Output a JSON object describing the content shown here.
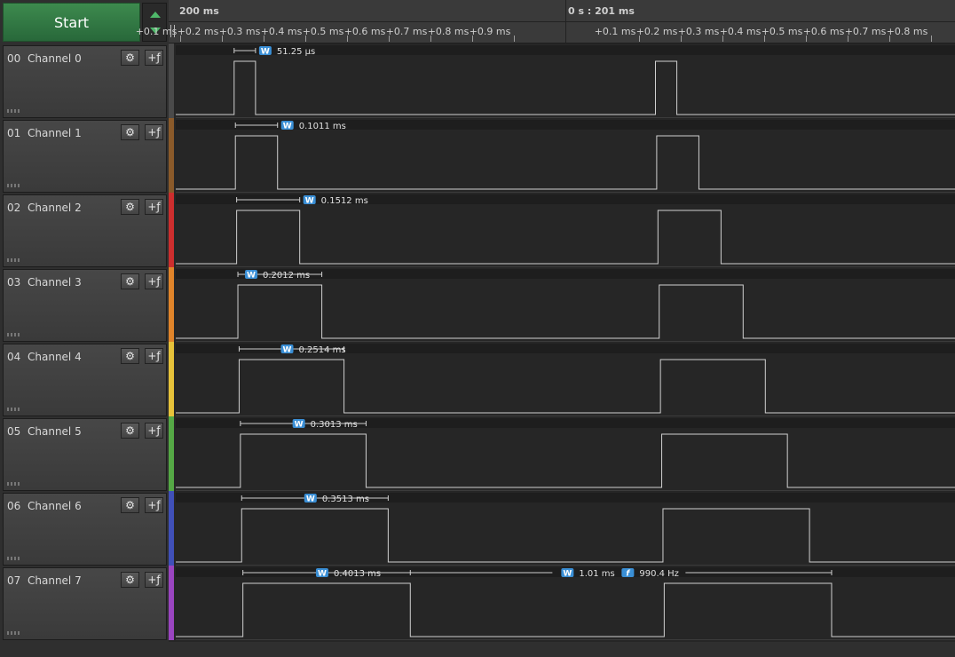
{
  "controls": {
    "start_label": "Start"
  },
  "timeline": {
    "left_label": "200 ms",
    "center_label": "0 s : 201 ms",
    "ticks_left": [
      "+0.1 ms",
      "+0.2 ms",
      "+0.3 ms",
      "+0.4 ms",
      "+0.5 ms",
      "+0.6 ms",
      "+0.7 ms",
      "+0.8 ms",
      "+0.9 ms"
    ],
    "ticks_right": [
      "+0.1 ms",
      "+0.2 ms",
      "+0.3 ms",
      "+0.4 ms",
      "+0.5 ms",
      "+0.6 ms",
      "+0.7 ms",
      "+0.8 ms"
    ]
  },
  "channels": [
    {
      "num": "00",
      "name": "Channel 0",
      "color": "#4a4a4a",
      "width_label": "51.25 µs",
      "width_ms": 0.05125
    },
    {
      "num": "01",
      "name": "Channel 1",
      "color": "#8a5a2a",
      "width_label": "0.1011 ms",
      "width_ms": 0.1011
    },
    {
      "num": "02",
      "name": "Channel 2",
      "color": "#cc2e2e",
      "width_label": "0.1512 ms",
      "width_ms": 0.1512
    },
    {
      "num": "03",
      "name": "Channel 3",
      "color": "#e0842a",
      "width_label": "0.2012 ms",
      "width_ms": 0.2012
    },
    {
      "num": "04",
      "name": "Channel 4",
      "color": "#e6c23a",
      "width_label": "0.2514 ms",
      "width_ms": 0.2514
    },
    {
      "num": "05",
      "name": "Channel 5",
      "color": "#55a845",
      "width_label": "0.3013 ms",
      "width_ms": 0.3013
    },
    {
      "num": "06",
      "name": "Channel 6",
      "color": "#4050b8",
      "width_label": "0.3513 ms",
      "width_ms": 0.3513
    },
    {
      "num": "07",
      "name": "Channel 7",
      "color": "#9a45c0",
      "width_label": "0.4013 ms",
      "width_ms": 0.4013
    }
  ],
  "measurement": {
    "period_label": "1.01 ms",
    "frequency_label": "990.4 Hz",
    "width_marker": "W",
    "frequency_marker": "f"
  },
  "icons": {
    "settings": "gear-icon",
    "trigger": "trigger-edge-icon",
    "grip": "drag-grip-icon"
  }
}
